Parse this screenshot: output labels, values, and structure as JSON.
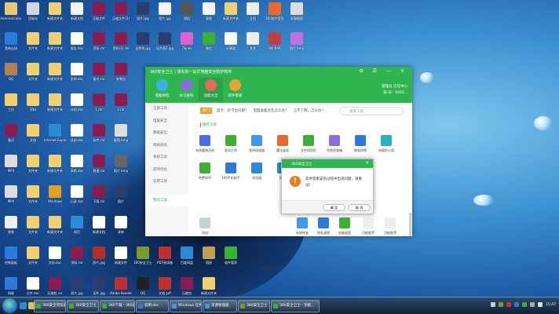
{
  "desktop": {
    "icons": [
      {
        "label": "Administrator",
        "color": "#e8c870"
      },
      {
        "label": "回收站",
        "color": "#cfd8e0"
      },
      {
        "label": "新建文件夹",
        "color": "#f0d070"
      },
      {
        "label": "新建文档",
        "color": "#f4f4f4"
      },
      {
        "label": "压缩文件",
        "color": "#8b1c50"
      },
      {
        "label": "压缩文件(2)",
        "color": "#8b1c50"
      },
      {
        "label": "照片.jpg",
        "color": "#2c3e70"
      },
      {
        "label": "图片.jpg",
        "color": "#f4f4f4"
      },
      {
        "label": "相机",
        "color": "#555"
      },
      {
        "label": "表格",
        "color": "#f4f4f4"
      },
      {
        "label": "新建文件夹",
        "color": "#f0d070"
      },
      {
        "label": "文档",
        "color": "#eee"
      },
      {
        "label": "360软件管家",
        "color": "#e86a2a"
      },
      {
        "label": "屏幕截图",
        "color": "#ddd"
      },
      {
        "label": "宽带连接",
        "color": "#2c7ae0"
      },
      {
        "label": "文件夹",
        "color": "#f0d070"
      },
      {
        "label": "新建文件夹",
        "color": "#f0d070"
      },
      {
        "label": "报告.doc",
        "color": "#fff"
      },
      {
        "label": "资料.rar",
        "color": "#8b1c50"
      },
      {
        "label": "资料(2).rar",
        "color": "#8b1c50"
      },
      {
        "label": "证件照.jpg",
        "color": "#2c3e70"
      },
      {
        "label": "证件照2.jpg",
        "color": "#2c3e70"
      },
      {
        "label": "iTunes",
        "color": "#e060d0"
      },
      {
        "label": "微信",
        "color": "#3cb034"
      },
      {
        "label": "计算器",
        "color": "#fff"
      },
      {
        "label": "文本",
        "color": "#eee"
      },
      {
        "label": "WinRAR",
        "color": "#c04040"
      },
      {
        "label": "图片.bmp",
        "color": "#c070e0"
      },
      {
        "label": "QQ",
        "color": "#b08050"
      },
      {
        "label": "文件夹",
        "color": "#f0d070"
      },
      {
        "label": "新建文件夹",
        "color": "#f0d070"
      },
      {
        "label": "说明.doc",
        "color": "#fff"
      },
      {
        "label": "备份.rar",
        "color": "#8b1c50"
      },
      {
        "label": "安装包",
        "color": "#8b1c50"
      },
      {
        "label": "工作",
        "color": "#f0d070"
      },
      {
        "label": "资料",
        "color": "#f0d070"
      },
      {
        "label": "新建文件夹",
        "color": "#f0d070"
      },
      {
        "label": "计划.doc",
        "color": "#fff"
      },
      {
        "label": "1.rar",
        "color": "#8b1c50"
      },
      {
        "label": "2.rar",
        "color": "#8b1c50"
      },
      {
        "label": "备份",
        "color": "#8b1c50"
      },
      {
        "label": "文档",
        "color": "#f0d070"
      },
      {
        "label": "Internet Explorer",
        "color": "#2a8ad8"
      },
      {
        "label": "总结.doc",
        "color": "#fff"
      },
      {
        "label": "软件.rar",
        "color": "#8b1c50"
      },
      {
        "label": "截图.bmp",
        "color": "#ddd"
      },
      {
        "label": "MP3",
        "color": "#ddd"
      },
      {
        "label": "文件夹",
        "color": "#f0d070"
      },
      {
        "label": "新建文件夹",
        "color": "#f0d070"
      },
      {
        "label": "表格.doc",
        "color": "#fff"
      },
      {
        "label": "数据.rar",
        "color": "#8b1c50"
      },
      {
        "label": "照片.bmp",
        "color": "#666"
      },
      {
        "label": "MP4",
        "color": "#ddd"
      },
      {
        "label": "文件夹",
        "color": "#f0d070"
      },
      {
        "label": "Windows",
        "color": "#e0a020"
      },
      {
        "label": "记录.doc",
        "color": "#fff"
      },
      {
        "label": "下载.rar",
        "color": "#8b1c50"
      },
      {
        "label": "图片",
        "color": "#2c3e70"
      },
      {
        "label": "视频",
        "color": "#eee"
      },
      {
        "label": "文件夹",
        "color": "#f0d070"
      },
      {
        "label": "新建文件夹",
        "color": "#f0d070"
      },
      {
        "label": "网页",
        "color": "#2a8ad8"
      },
      {
        "label": "新建文档",
        "color": "#fff"
      },
      {
        "label": "表单",
        "color": "#fff"
      },
      {
        "label": "控制面板",
        "color": "#2c7ae0"
      },
      {
        "label": "文件夹",
        "color": "#f0d070"
      },
      {
        "label": "文档.doc",
        "color": "#fff"
      },
      {
        "label": "资料.rar",
        "color": "#8b1c50"
      },
      {
        "label": "照片.jpg",
        "color": "#b03030"
      },
      {
        "label": "新建文件",
        "color": "#fff"
      },
      {
        "label": "360安全卫士",
        "color": "#7a9a2a"
      },
      {
        "label": "PDF阅读器",
        "color": "#c03030"
      },
      {
        "label": "百度网盘",
        "color": "#2a8ad8"
      },
      {
        "label": "相册",
        "color": "#c0a050"
      },
      {
        "label": "软件管家",
        "color": "#3cb034"
      },
      {
        "label": "网络",
        "color": "#2c7ae0"
      },
      {
        "label": "文件.doc",
        "color": "#fff"
      },
      {
        "label": "压缩包.rar",
        "color": "#8b1c50"
      },
      {
        "label": "照片.jpg",
        "color": "#2c3e70"
      },
      {
        "label": "证件.jpg",
        "color": "#2c3e70"
      },
      {
        "label": "Adobe Reader",
        "color": "#c03030"
      },
      {
        "label": "QQ",
        "color": "#222"
      },
      {
        "label": "文档.pdf",
        "color": "#c03030"
      },
      {
        "label": "压缩包",
        "color": "#8b1c50"
      },
      {
        "label": "新建文件夹",
        "color": "#f0d070"
      }
    ]
  },
  "window": {
    "title": "360安全卫士 | 领先的一站式电脑安全防护软件",
    "controls": "⚙ ☰ — ✕",
    "tabs": [
      {
        "label": "电脑体检",
        "color": "#3db0e8"
      },
      {
        "label": "木马查杀",
        "color": "#8a6ee0"
      },
      {
        "label": "功能大全",
        "color": "#e86a5a",
        "active": true
      },
      {
        "label": "软件管家",
        "color": "#f0a030"
      }
    ],
    "account": {
      "line1": "管理员   信任中心",
      "line2": "账 号：0402..."
    },
    "sidebar": [
      "全部工具",
      "电脑安全",
      "数据安全",
      "网络优化",
      "系统工具",
      "游戏优化",
      "实用工具"
    ],
    "sidebar_my": "我的工具",
    "hot_badge": "热门",
    "hot_items": [
      "显卡、声卡出问题？",
      "电脑桌面太乱怎么办？",
      "上不了网，怎么办？"
    ],
    "search_placeholder": "搜索工具",
    "section_title": "推荐工具",
    "tools_row1": [
      {
        "label": "系统重装还原",
        "color": "#4a6ee0"
      },
      {
        "label": "驱动大师",
        "color": "#3cb034"
      },
      {
        "label": "宽带测速器",
        "color": "#3d9ae8"
      },
      {
        "label": "魔法桌面",
        "color": "#e86a2a"
      },
      {
        "label": "文件保险柜",
        "color": "#3cb034"
      },
      {
        "label": "系统急救箱",
        "color": "#8a6ee0"
      },
      {
        "label": "隐私保镖",
        "color": "#2a7ae0"
      },
      {
        "label": "流量防火墙",
        "color": "#2ab0c0"
      }
    ],
    "tools_row2": [
      {
        "label": "免费WiFi",
        "color": "#3cb034"
      },
      {
        "label": "360手机助手",
        "color": "#2a7ae0"
      },
      {
        "label": "浏览器",
        "color": "#2a8ad8"
      },
      {
        "label": "网络",
        "color": "#2a8ad8"
      }
    ],
    "tools_row3": [
      {
        "label": "添加",
        "color": "#c8d0d8"
      },
      {
        "label": "系统修复",
        "color": "#3d9ae8"
      },
      {
        "label": "隐私清理",
        "color": "#2a7ae0"
      },
      {
        "label": "电脑桌面",
        "color": "#3cb034"
      },
      {
        "label": "功能推荐",
        "color": "#eee"
      },
      {
        "label": "功能推荐",
        "color": "#eee"
      }
    ],
    "tools_row3_link": "工具按分类入门"
  },
  "dialog": {
    "title": "360安全卫士",
    "message": "软件管家安装过程中出现问题，请重试！",
    "ok": "确 定",
    "cancel": "取 消"
  },
  "taskbar": {
    "buttons": [
      {
        "label": "360安全浏览器 - ...",
        "color": "#3cb034"
      },
      {
        "label": "360安全卫士_百度搜索...",
        "color": "#3cb034"
      },
      {
        "label": "360下载 - 360安全...",
        "color": "#3cb034"
      },
      {
        "label": "说明.doc",
        "color": "#2a7ae0"
      },
      {
        "label": "Windows 任务管理器",
        "color": "#3d9ae8"
      },
      {
        "label": "资源管理器",
        "color": "#3d9ae8"
      },
      {
        "label": "360安全卫士",
        "color": "#7a9a2a"
      },
      {
        "label": "360安全卫士 - 功能...",
        "color": "#3cb034"
      }
    ],
    "clock": "15:47"
  }
}
